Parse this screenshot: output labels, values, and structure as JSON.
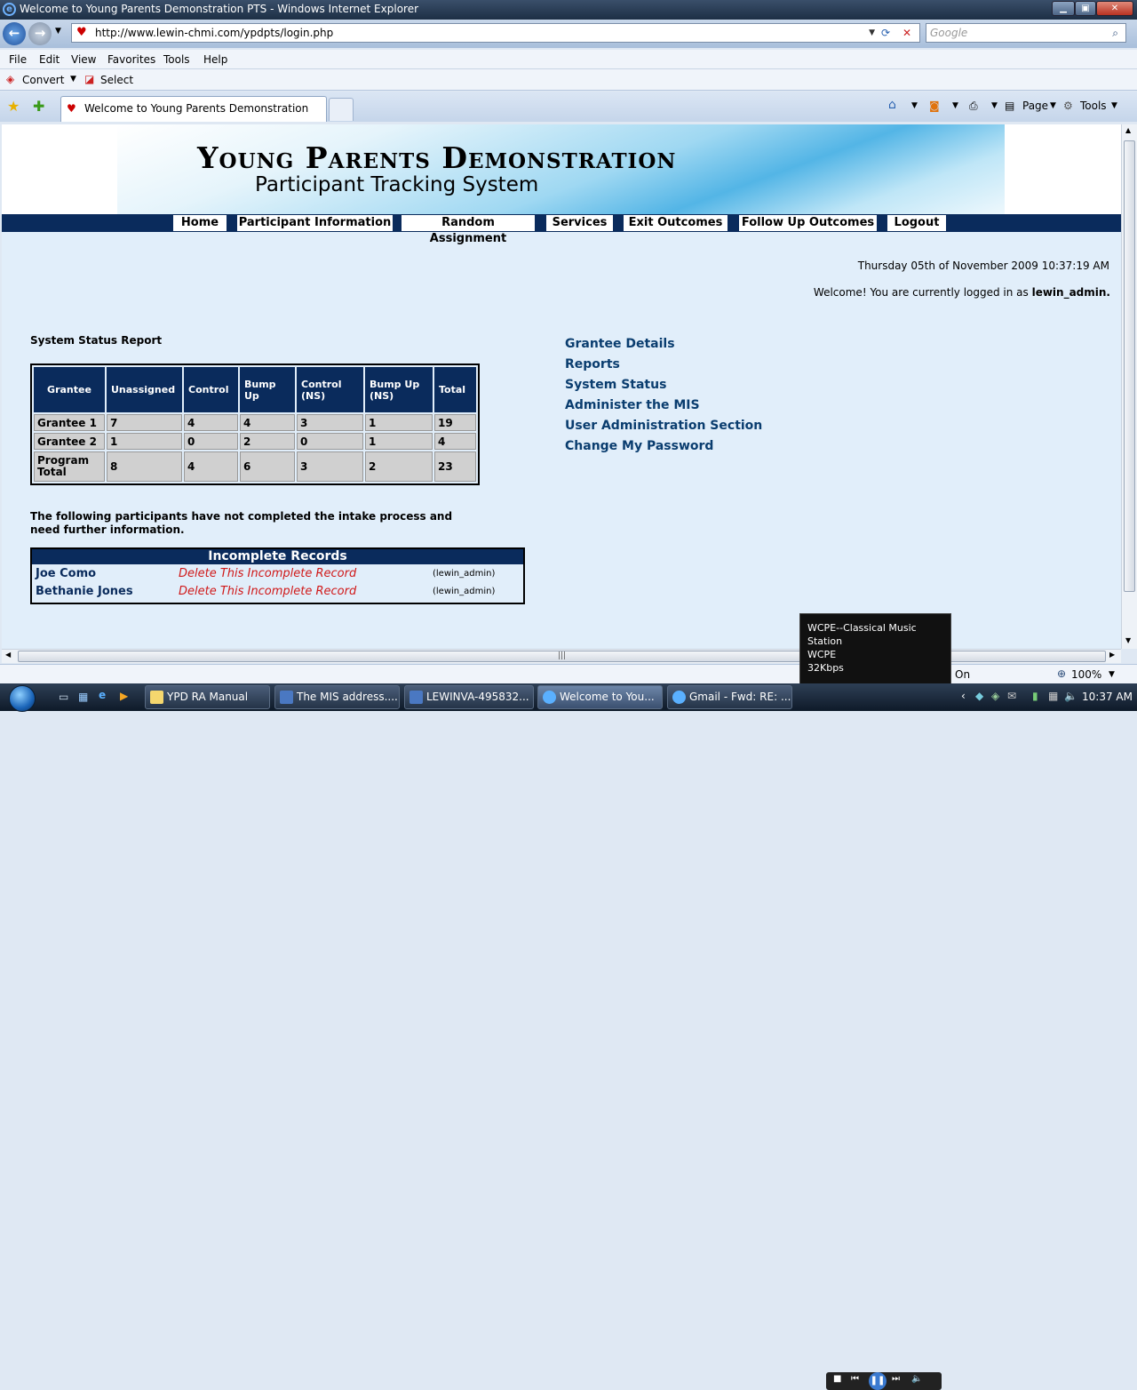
{
  "window": {
    "title": "Welcome to Young Parents Demonstration PTS - Windows Internet Explorer"
  },
  "address": {
    "url": "http://www.lewin-chmi.com/ypdpts/login.php",
    "search_placeholder": "Google"
  },
  "menu": [
    "File",
    "Edit",
    "View",
    "Favorites",
    "Tools",
    "Help"
  ],
  "toolbar": {
    "convert": "Convert",
    "select": "Select"
  },
  "tab": {
    "title": "Welcome to Young Parents Demonstration PTS"
  },
  "commands": {
    "page": "Page",
    "tools": "Tools"
  },
  "banner": {
    "title": "Young Parents Demonstration",
    "subtitle": "Participant Tracking System"
  },
  "nav": [
    "Home",
    "Participant Information",
    "Random Assignment",
    "Services",
    "Exit Outcomes",
    "Follow Up Outcomes",
    "Logout"
  ],
  "datetime": "Thursday 05th of November 2009 10:37:19 AM",
  "welcome": {
    "text": "Welcome! You are currently logged in as ",
    "user": "lewin_admin."
  },
  "status_report": {
    "title": "System Status Report",
    "headers": [
      "Grantee",
      "Unassigned",
      "Control",
      "Bump Up",
      "Control (NS)",
      "Bump Up (NS)",
      "Total"
    ],
    "rows": [
      [
        "Grantee 1",
        "7",
        "4",
        "4",
        "3",
        "1",
        "19"
      ],
      [
        "Grantee 2",
        "1",
        "0",
        "2",
        "0",
        "1",
        "4"
      ],
      [
        "Program Total",
        "8",
        "4",
        "6",
        "3",
        "2",
        "23"
      ]
    ]
  },
  "incomplete": {
    "intro": "The following participants have not completed the intake process and need further information.",
    "title": "Incomplete Records",
    "rows": [
      {
        "name": "Joe Como",
        "action": "Delete This Incomplete Record",
        "user": "(lewin_admin)"
      },
      {
        "name": "Bethanie Jones",
        "action": "Delete This Incomplete Record",
        "user": "(lewin_admin)"
      }
    ]
  },
  "links": [
    "Grantee Details",
    "Reports",
    "System Status",
    "Administer the MIS",
    "User Administration Section",
    "Change My Password"
  ],
  "statusbar": {
    "protected_mode": "On",
    "zoom": "100%"
  },
  "popup": {
    "line1": "WCPE--Classical Music Station",
    "line2": "WCPE",
    "line3": "32Kbps"
  },
  "taskbar": {
    "buttons": [
      "YPD RA Manual",
      "The MIS address....",
      "LEWINVA-495832...",
      "Welcome to You...",
      "Gmail - Fwd: RE: ..."
    ],
    "clock": "10:37 AM"
  }
}
